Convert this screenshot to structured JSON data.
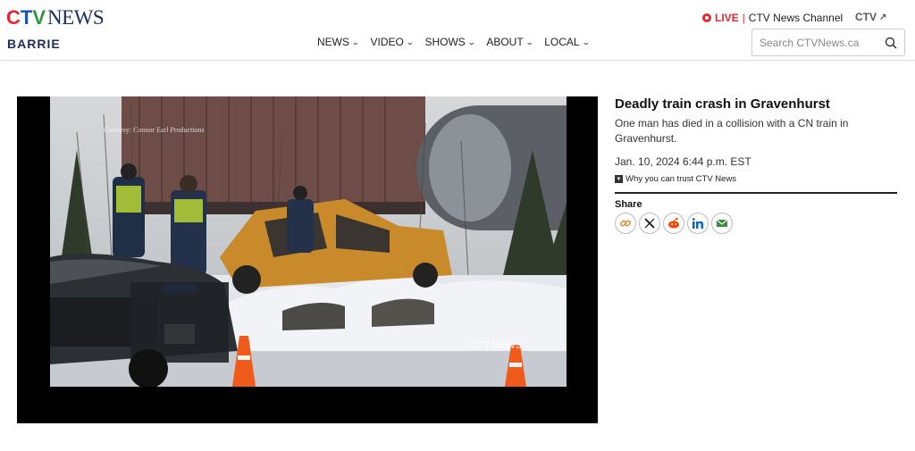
{
  "header": {
    "logo": {
      "c": "C",
      "t": "T",
      "v": "V",
      "news": "NEWS"
    },
    "region": "BARRIE",
    "nav": [
      {
        "label": "NEWS"
      },
      {
        "label": "VIDEO"
      },
      {
        "label": "SHOWS"
      },
      {
        "label": "ABOUT"
      },
      {
        "label": "LOCAL"
      }
    ],
    "live": {
      "label": "LIVE",
      "separator": "|",
      "channel": "CTV News Channel"
    },
    "ctv_link": "CTV",
    "search": {
      "placeholder": "Search CTVNews.ca"
    }
  },
  "player": {
    "courtesy": "Courtesy: Connor Earl Productions",
    "watermark": "CTV NEWS"
  },
  "article": {
    "headline": "Deadly train crash in Gravenhurst",
    "summary": "One man has died in a collision with a CN train in Gravenhurst.",
    "date": "Jan. 10, 2024 6:44 p.m. EST",
    "trust": "Why you can trust CTV News",
    "share_label": "Share",
    "share_buttons": [
      "link-icon",
      "x-icon",
      "reddit-icon",
      "linkedin-icon",
      "email-icon"
    ]
  },
  "colors": {
    "brand_navy": "#1d2c5e",
    "live_red": "#e8262d",
    "ctv_blue": "#1a56b8",
    "ctv_green": "#2e9a3e",
    "link_orange": "#e98a2a",
    "reddit_red": "#ff4500",
    "linkedin_blue": "#0a66c2",
    "email_green": "#3b8a3e"
  }
}
